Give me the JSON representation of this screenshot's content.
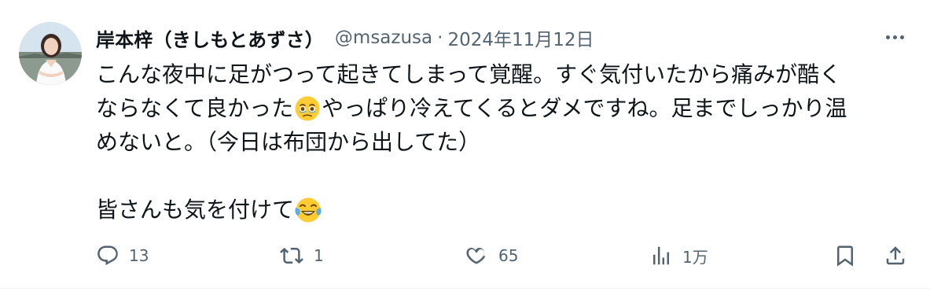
{
  "author": {
    "display_name": "岸本梓（きしもとあずさ）",
    "handle": "@msazusa",
    "separator": "·",
    "date": "2024年11月12日"
  },
  "tweet": {
    "line1": "こんな夜中に足がつって起きてしまって覚醒。すぐ気付いたから痛みが酷く",
    "line2a": "ならなくて良かった",
    "line2b": "やっぱり冷えてくるとダメですね。足までしっかり温",
    "line3": "めないと。（今日は布団から出してた）",
    "line4": "皆さんも気を付けて"
  },
  "actions": {
    "reply_count": "13",
    "retweet_count": "1",
    "like_count": "65",
    "views_count": "1万"
  },
  "icons": {
    "more": "more-horizontal-icon",
    "reply": "reply-icon",
    "retweet": "retweet-icon",
    "like": "heart-icon",
    "views": "views-bar-chart-icon",
    "bookmark": "bookmark-icon",
    "share": "share-icon",
    "emoji1": "holding-back-tears-emoji",
    "emoji2": "tears-of-joy-emoji"
  },
  "colors": {
    "text": "#0f1419",
    "muted": "#536471",
    "emoji_yellow": "#ffcc33"
  }
}
